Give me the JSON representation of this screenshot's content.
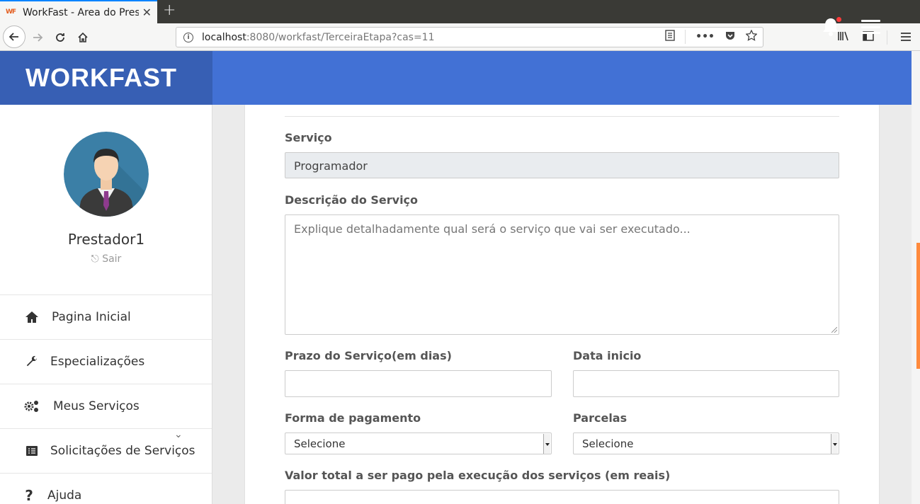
{
  "browser": {
    "tab_title": "WorkFast - Area do Prest",
    "tab_favicon": "WF",
    "url_host": "localhost",
    "url_path": ":8080/workfast/TerceiraEtapa?cas=11",
    "icons": [
      "back-arrow-icon",
      "forward-arrow-icon",
      "reload-icon",
      "home-icon",
      "info-icon",
      "reader-view-icon",
      "more-icon",
      "pocket-icon",
      "bookmark-star-icon",
      "library-icon",
      "sidebar-icon",
      "menu-icon"
    ]
  },
  "header": {
    "brand": "WORKFAST",
    "accent": "#4271d5",
    "brand_bg": "#375fb4",
    "notification_dot_color": "#ff3b3b"
  },
  "sidebar": {
    "user_name": "Prestador1",
    "logout_label": "Sair",
    "items": [
      {
        "label": "Pagina Inicial",
        "icon": "home-icon"
      },
      {
        "label": "Especializações",
        "icon": "wrench-icon"
      },
      {
        "label": "Meus Serviços",
        "icon": "gears-icon"
      },
      {
        "label": "Solicitações de Serviços",
        "icon": "list-icon"
      },
      {
        "label": "Ajuda",
        "icon": "question-icon"
      }
    ]
  },
  "form": {
    "servico_label": "Serviço",
    "servico_value": "Programador",
    "descricao_label": "Descrição do Serviço",
    "descricao_placeholder": "Explique detalhadamente qual será o serviço que vai ser executado...",
    "prazo_label": "Prazo do Serviço(em dias)",
    "data_inicio_label": "Data inicio",
    "pagamento_label": "Forma de pagamento",
    "pagamento_value": "Selecione",
    "parcelas_label": "Parcelas",
    "parcelas_value": "Selecione",
    "valor_label": "Valor total a ser pago pela execução dos serviços (em reais)"
  }
}
